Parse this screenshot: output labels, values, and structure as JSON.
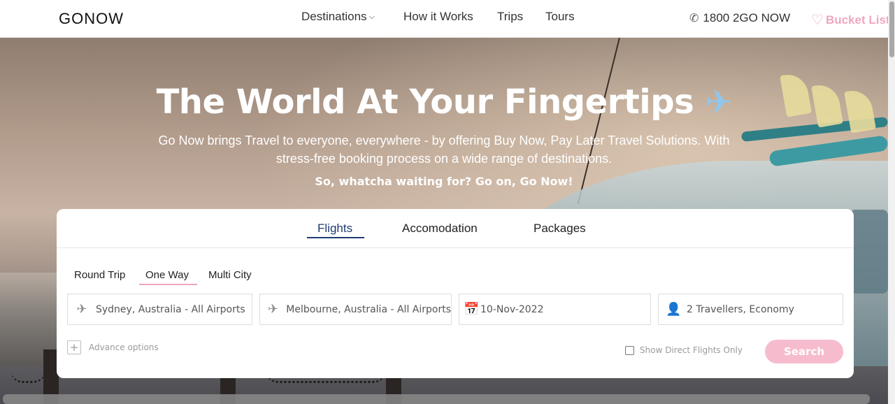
{
  "header": {
    "logo": "GONOW",
    "nav": [
      {
        "label": "Destinations",
        "has_dropdown": true
      },
      {
        "label": "How it Works"
      },
      {
        "label": "Trips"
      },
      {
        "label": "Tours"
      }
    ],
    "phone": "1800 2GO NOW",
    "phone_icon": "phone-icon",
    "bucket_list": "Bucket List",
    "bucket_icon": "heart-icon"
  },
  "hero": {
    "title": "The World At Your Fingertips",
    "title_icon": "airplane-icon",
    "subtitle": "Go Now brings Travel to everyone, everywhere - by offering Buy Now, Pay Later Travel Solutions. With stress-free booking process on a wide range of destinations.",
    "cta": "So, whatcha waiting for? Go on, Go Now!"
  },
  "search": {
    "tabs": [
      {
        "label": "Flights",
        "active": true
      },
      {
        "label": "Accomodation"
      },
      {
        "label": "Packages"
      }
    ],
    "trip_types": [
      {
        "label": "Round Trip"
      },
      {
        "label": "One Way",
        "active": true
      },
      {
        "label": "Multi City"
      }
    ],
    "from": "Sydney, Australia - All Airports",
    "to": "Melbourne, Australia - All Airports",
    "date": "10-Nov-2022",
    "travellers": "2 Travellers, Economy",
    "advance_options": "Advance options",
    "direct_only": "Show Direct Flights Only",
    "direct_checked": false,
    "search_button": "Search"
  },
  "colors": {
    "accent_pink": "#f0a6c0",
    "search_button": "#f6bccd",
    "tab_active": "#1f3b73"
  }
}
